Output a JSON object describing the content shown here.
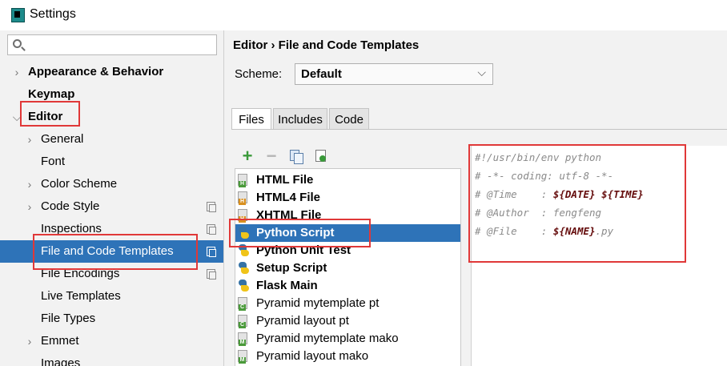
{
  "window": {
    "title": "Settings"
  },
  "search": {
    "placeholder": ""
  },
  "tree": {
    "items": [
      {
        "label": "Appearance & Behavior",
        "level": 0,
        "bold": true,
        "expandable": true,
        "expanded": false
      },
      {
        "label": "Keymap",
        "level": 0,
        "bold": true,
        "expandable": false
      },
      {
        "label": "Editor",
        "level": 0,
        "bold": true,
        "expandable": true,
        "expanded": true
      },
      {
        "label": "General",
        "level": 1,
        "expandable": true,
        "expanded": false
      },
      {
        "label": "Font",
        "level": 1,
        "expandable": false
      },
      {
        "label": "Color Scheme",
        "level": 1,
        "expandable": true,
        "expanded": false
      },
      {
        "label": "Code Style",
        "level": 1,
        "expandable": true,
        "expanded": false,
        "project_icon": true
      },
      {
        "label": "Inspections",
        "level": 1,
        "expandable": false,
        "project_icon": true
      },
      {
        "label": "File and Code Templates",
        "level": 1,
        "expandable": false,
        "selected": true,
        "project_icon": true
      },
      {
        "label": "File Encodings",
        "level": 1,
        "expandable": false,
        "project_icon": true
      },
      {
        "label": "Live Templates",
        "level": 1,
        "expandable": false
      },
      {
        "label": "File Types",
        "level": 1,
        "expandable": false
      },
      {
        "label": "Emmet",
        "level": 1,
        "expandable": true,
        "expanded": false
      },
      {
        "label": "Images",
        "level": 1,
        "expandable": false
      }
    ]
  },
  "main": {
    "breadcrumb": "Editor › File and Code Templates",
    "scheme_label": "Scheme:",
    "scheme_value": "Default",
    "tabs": [
      {
        "label": "Files",
        "active": true
      },
      {
        "label": "Includes",
        "active": false
      },
      {
        "label": "Code",
        "active": false
      }
    ],
    "toolbar": {
      "add": "+",
      "remove": "−"
    },
    "templates": [
      {
        "label": "HTML File",
        "icon": "html-file-icon",
        "badge": "H",
        "badge_color": "#4a9a3a",
        "bold": true
      },
      {
        "label": "HTML4 File",
        "icon": "html-file-icon",
        "badge": "H",
        "badge_color": "#d89020",
        "bold": true
      },
      {
        "label": "XHTML File",
        "icon": "html-file-icon",
        "badge": "H",
        "badge_color": "#d89020",
        "bold": true
      },
      {
        "label": "Python Script",
        "icon": "python-icon",
        "bold": true,
        "selected": true
      },
      {
        "label": "Python Unit Test",
        "icon": "python-icon",
        "bold": true
      },
      {
        "label": "Setup Script",
        "icon": "python-icon",
        "bold": true
      },
      {
        "label": "Flask Main",
        "icon": "python-icon",
        "bold": true
      },
      {
        "label": "Pyramid mytemplate pt",
        "icon": "chameleon-file-icon",
        "badge": "C",
        "badge_color": "#4a9a3a",
        "bold": false
      },
      {
        "label": "Pyramid layout pt",
        "icon": "chameleon-file-icon",
        "badge": "C",
        "badge_color": "#4a9a3a",
        "bold": false
      },
      {
        "label": "Pyramid mytemplate mako",
        "icon": "mako-file-icon",
        "badge": "M",
        "badge_color": "#4a9a3a",
        "bold": false
      },
      {
        "label": "Pyramid layout mako",
        "icon": "mako-file-icon",
        "badge": "M",
        "badge_color": "#4a9a3a",
        "bold": false
      }
    ],
    "editor_lines": [
      {
        "pre": "#!/usr/bin/env python",
        "var1": "",
        "mid": "",
        "var2": "",
        "post": ""
      },
      {
        "pre": "# -*- coding: utf-8 -*-",
        "var1": "",
        "mid": "",
        "var2": "",
        "post": ""
      },
      {
        "pre": "# @Time    : ",
        "var1": "${DATE}",
        "mid": " ",
        "var2": "${TIME}",
        "post": ""
      },
      {
        "pre": "# @Author  : fengfeng",
        "var1": "",
        "mid": "",
        "var2": "",
        "post": ""
      },
      {
        "pre": "# @File    : ",
        "var1": "${NAME}",
        "mid": "",
        "var2": "",
        "post": ".py"
      }
    ]
  },
  "colors": {
    "selection": "#2e73b8",
    "highlight_box": "#e03838",
    "template_var": "#660e0e",
    "comment": "#8a8a8a"
  }
}
